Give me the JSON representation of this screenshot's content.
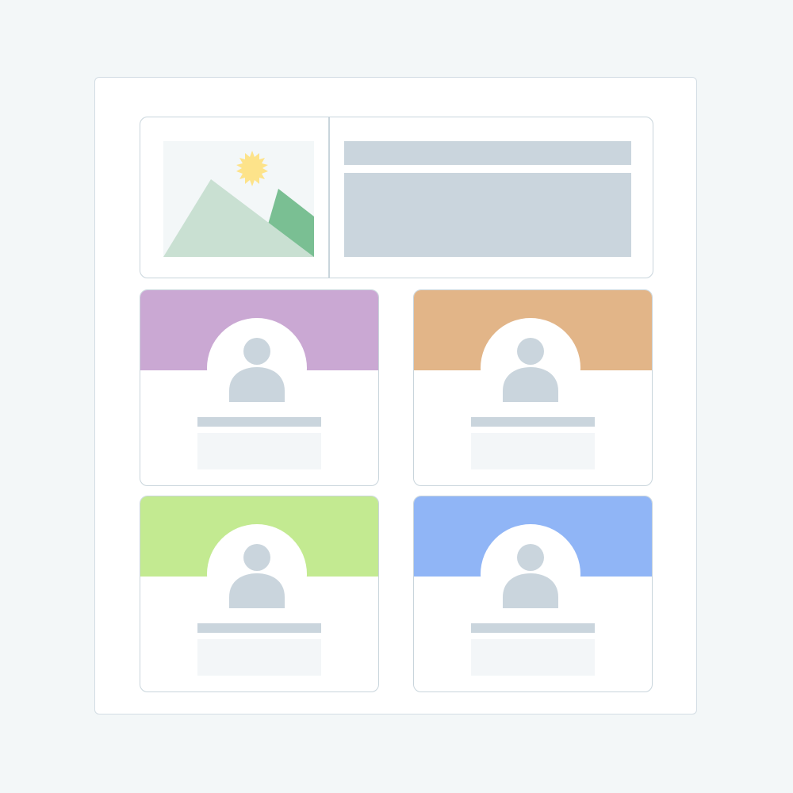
{
  "layout_name": "profile-cards-wireframe",
  "colors": {
    "background": "#f3f7f8",
    "panel": "#ffffff",
    "border": "#c9d5dc",
    "placeholder": "#cad5dd",
    "placeholder_light": "#f3f6f8",
    "sun": "#fde38a",
    "mountain_light": "#c9e0d2",
    "mountain_dark": "#7abf93"
  },
  "hero": {
    "image_icon": "landscape-image-icon"
  },
  "cards": [
    {
      "id": "card-1",
      "header_color": "#caa8d3",
      "icon": "user-avatar-icon"
    },
    {
      "id": "card-2",
      "header_color": "#e2b588",
      "icon": "user-avatar-icon"
    },
    {
      "id": "card-3",
      "header_color": "#c3ea91",
      "icon": "user-avatar-icon"
    },
    {
      "id": "card-4",
      "header_color": "#90b5f6",
      "icon": "user-avatar-icon"
    }
  ]
}
